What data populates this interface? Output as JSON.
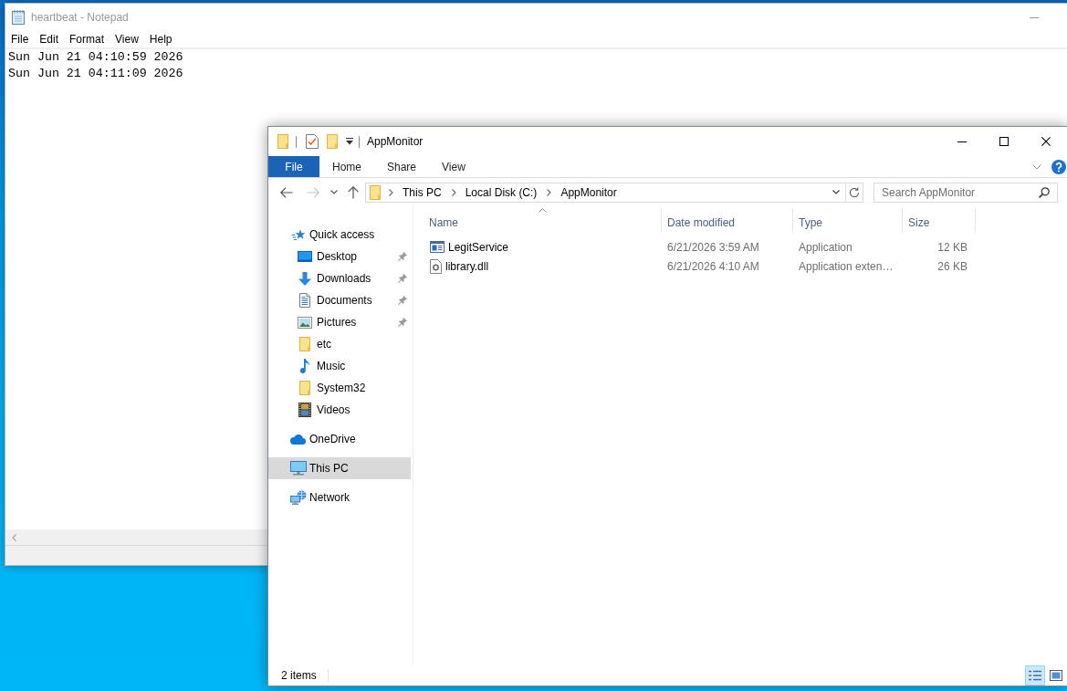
{
  "notepad": {
    "title": "heartbeat - Notepad",
    "active": false,
    "menu": [
      "File",
      "Edit",
      "Format",
      "View",
      "Help"
    ],
    "lines": [
      "Sun Jun 21 04:10:59 2026",
      "Sun Jun 21 04:11:09 2026"
    ]
  },
  "explorer": {
    "title": "AppMonitor",
    "active": true,
    "ribbon_tabs": [
      {
        "label": "File",
        "kind": "backstage"
      },
      {
        "label": "Home",
        "kind": "tab"
      },
      {
        "label": "Share",
        "kind": "tab"
      },
      {
        "label": "View",
        "kind": "tab"
      }
    ],
    "nav_buttons": [
      {
        "kind": "back",
        "disabled": false
      },
      {
        "kind": "forward",
        "disabled": true
      },
      {
        "kind": "recent",
        "disabled": false
      },
      {
        "kind": "up",
        "disabled": false
      }
    ],
    "address": [
      "This PC",
      "Local Disk (C:)",
      "AppMonitor"
    ],
    "search": {
      "placeholder": "Search AppMonitor"
    },
    "nav": [
      {
        "label": "Quick access",
        "kind": "quickaccess",
        "selected": false,
        "children": [
          {
            "label": "Desktop",
            "kind": "desktop",
            "pinned": true,
            "selected": false
          },
          {
            "label": "Downloads",
            "kind": "downloads",
            "pinned": true,
            "selected": false
          },
          {
            "label": "Documents",
            "kind": "documents",
            "pinned": true,
            "selected": false
          },
          {
            "label": "Pictures",
            "kind": "pictures",
            "pinned": true,
            "selected": false
          },
          {
            "label": "etc",
            "kind": "folder",
            "pinned": false,
            "selected": false
          },
          {
            "label": "Music",
            "kind": "music",
            "pinned": false,
            "selected": false
          },
          {
            "label": "System32",
            "kind": "folder",
            "pinned": false,
            "selected": false
          },
          {
            "label": "Videos",
            "kind": "videos",
            "pinned": false,
            "selected": false
          }
        ]
      },
      {
        "label": "OneDrive",
        "kind": "onedrive",
        "selected": false
      },
      {
        "label": "This PC",
        "kind": "computer",
        "selected": true
      },
      {
        "label": "Network",
        "kind": "network",
        "selected": false
      }
    ],
    "columns": [
      {
        "label": "Name",
        "sorted": true
      },
      {
        "label": "Date modified",
        "sorted": false
      },
      {
        "label": "Type",
        "sorted": false
      },
      {
        "label": "Size",
        "sorted": false
      }
    ],
    "files": [
      {
        "name": "LegitService",
        "kind": "application",
        "date_modified": "6/21/2026 3:59 AM",
        "type": "Application",
        "size": "12 KB"
      },
      {
        "name": "library.dll",
        "kind": "extension",
        "date_modified": "6/21/2026 4:10 AM",
        "type": "Application exten…",
        "size": "26 KB"
      }
    ],
    "status": "2 items",
    "view_buttons": [
      {
        "kind": "details",
        "selected": true
      },
      {
        "kind": "tiles",
        "selected": false
      }
    ]
  }
}
